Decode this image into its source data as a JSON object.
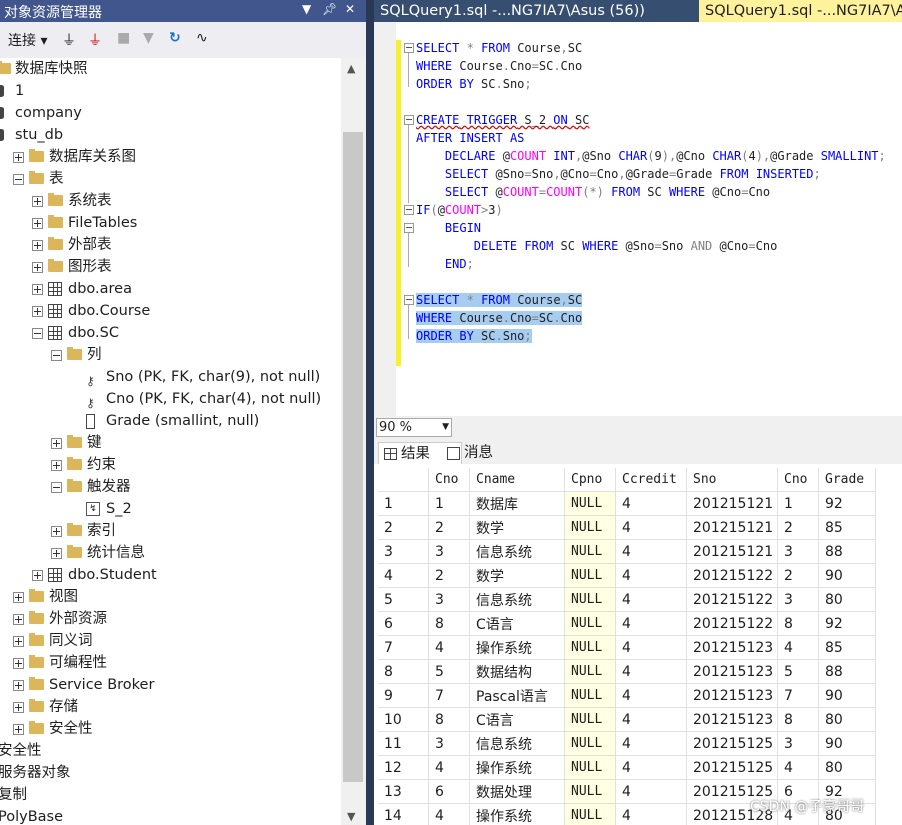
{
  "object_explorer": {
    "title": "对象资源管理器",
    "pin_controls": [
      "▼",
      "ᵖ",
      "✕"
    ],
    "toolbar": {
      "connect_label": "连接",
      "connect_arrow": "▾"
    },
    "tree": [
      {
        "label": "数据库快照",
        "icon": "folder-icon"
      },
      {
        "label": "1",
        "icon": "database-icon"
      },
      {
        "label": "company",
        "icon": "database-icon"
      },
      {
        "label": "stu_db",
        "icon": "database-icon"
      },
      {
        "label": "数据库关系图",
        "icon": "folder-icon"
      },
      {
        "label": "表",
        "icon": "folder-icon"
      },
      {
        "label": "系统表",
        "icon": "folder-icon"
      },
      {
        "label": "FileTables",
        "icon": "folder-icon"
      },
      {
        "label": "外部表",
        "icon": "folder-icon"
      },
      {
        "label": "图形表",
        "icon": "folder-icon"
      },
      {
        "label": "dbo.area",
        "icon": "table-icon"
      },
      {
        "label": "dbo.Course",
        "icon": "table-icon"
      },
      {
        "label": "dbo.SC",
        "icon": "table-icon"
      },
      {
        "label": "列",
        "icon": "folder-icon"
      },
      {
        "label": "Sno (PK, FK, char(9), not null)",
        "icon": "key-icon"
      },
      {
        "label": "Cno (PK, FK, char(4), not null)",
        "icon": "key-icon"
      },
      {
        "label": "Grade (smallint, null)",
        "icon": "column-icon"
      },
      {
        "label": "键",
        "icon": "folder-icon"
      },
      {
        "label": "约束",
        "icon": "folder-icon"
      },
      {
        "label": "触发器",
        "icon": "folder-icon"
      },
      {
        "label": "S_2",
        "icon": "trigger-icon"
      },
      {
        "label": "索引",
        "icon": "folder-icon"
      },
      {
        "label": "统计信息",
        "icon": "folder-icon"
      },
      {
        "label": "dbo.Student",
        "icon": "table-icon"
      },
      {
        "label": "视图",
        "icon": "folder-icon"
      },
      {
        "label": "外部资源",
        "icon": "folder-icon"
      },
      {
        "label": "同义词",
        "icon": "folder-icon"
      },
      {
        "label": "可编程性",
        "icon": "folder-icon"
      },
      {
        "label": "Service Broker",
        "icon": "folder-icon"
      },
      {
        "label": "存储",
        "icon": "folder-icon"
      },
      {
        "label": "安全性",
        "icon": "folder-icon"
      },
      {
        "label": "安全性",
        "icon": "none"
      },
      {
        "label": "服务器对象",
        "icon": "none"
      },
      {
        "label": "复制",
        "icon": "none"
      },
      {
        "label": "PolyBase",
        "icon": "none"
      }
    ]
  },
  "tabs": {
    "tab1": "SQLQuery1.sql -...NG7IA7\\Asus (56))",
    "tab2": "SQLQuery1.sql -...NG7IA7\\A"
  },
  "editor": {
    "zoom": "90 %",
    "lines": [
      "SELECT * FROM Course,SC",
      "WHERE Course.Cno=SC.Cno",
      "ORDER BY SC.Sno;",
      "",
      "CREATE TRIGGER S_2 ON SC",
      "AFTER INSERT AS",
      "    DECLARE @COUNT INT,@Sno CHAR(9),@Cno CHAR(4),@Grade SMALLINT;",
      "    SELECT @Sno=Sno,@Cno=Cno,@Grade=Grade FROM INSERTED;",
      "    SELECT @COUNT=COUNT(*) FROM SC WHERE @Cno=Cno",
      "IF(@COUNT>3)",
      "    BEGIN",
      "        DELETE FROM SC WHERE @Sno=Sno AND @Cno=Cno",
      "    END;",
      "",
      "SELECT * FROM Course,SC",
      "WHERE Course.Cno=SC.Cno",
      "ORDER BY SC.Sno;"
    ]
  },
  "results": {
    "tab_results": "结果",
    "tab_messages": "消息",
    "columns": [
      "",
      "Cno",
      "Cname",
      "Cpno",
      "Ccredit",
      "Sno",
      "Cno",
      "Grade"
    ],
    "rows": [
      [
        "1",
        "1",
        "数据库",
        "NULL",
        "4",
        "201215121",
        "1",
        "92"
      ],
      [
        "2",
        "2",
        "数学",
        "NULL",
        "4",
        "201215121",
        "2",
        "85"
      ],
      [
        "3",
        "3",
        "信息系统",
        "NULL",
        "4",
        "201215121",
        "3",
        "88"
      ],
      [
        "4",
        "2",
        "数学",
        "NULL",
        "4",
        "201215122",
        "2",
        "90"
      ],
      [
        "5",
        "3",
        "信息系统",
        "NULL",
        "4",
        "201215122",
        "3",
        "80"
      ],
      [
        "6",
        "8",
        "C语言",
        "NULL",
        "4",
        "201215122",
        "8",
        "92"
      ],
      [
        "7",
        "4",
        "操作系统",
        "NULL",
        "4",
        "201215123",
        "4",
        "85"
      ],
      [
        "8",
        "5",
        "数据结构",
        "NULL",
        "4",
        "201215123",
        "5",
        "88"
      ],
      [
        "9",
        "7",
        "Pascal语言",
        "NULL",
        "4",
        "201215123",
        "7",
        "90"
      ],
      [
        "10",
        "8",
        "C语言",
        "NULL",
        "4",
        "201215123",
        "8",
        "80"
      ],
      [
        "11",
        "3",
        "信息系统",
        "NULL",
        "4",
        "201215125",
        "3",
        "90"
      ],
      [
        "12",
        "4",
        "操作系统",
        "NULL",
        "4",
        "201215125",
        "4",
        "80"
      ],
      [
        "13",
        "6",
        "数据处理",
        "NULL",
        "4",
        "201215125",
        "6",
        "92"
      ],
      [
        "14",
        "4",
        "操作系统",
        "NULL",
        "4",
        "201215128",
        "4",
        "80"
      ]
    ]
  },
  "watermark": "CSDN @子豪哥哥",
  "colors": {
    "title_bar": "#40568d",
    "tab_active": "#fff29d",
    "selection": "#a6cdf0",
    "keyword": "#0000ff"
  }
}
